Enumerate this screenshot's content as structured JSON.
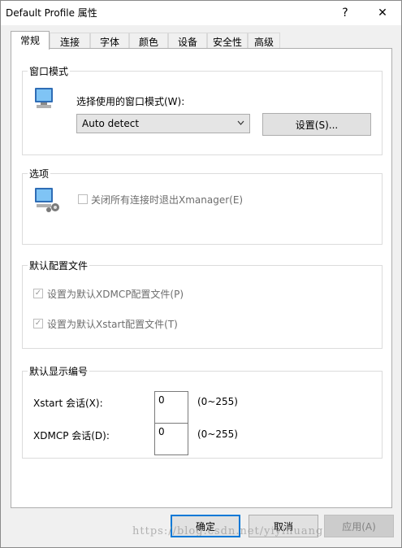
{
  "window": {
    "title": "Default Profile 属性",
    "help": "?",
    "close": "✕"
  },
  "tabs": [
    "常规",
    "连接",
    "字体",
    "颜色",
    "设备",
    "安全性",
    "高级"
  ],
  "window_mode": {
    "group_title": "窗口模式",
    "prompt": "选择使用的窗口模式(W):",
    "select_value": "Auto detect",
    "settings_button": "设置(S)..."
  },
  "options": {
    "group_title": "选项",
    "exit_checkbox_label": "关闭所有连接时退出Xmanager(E)",
    "exit_checked": false
  },
  "default_profile": {
    "group_title": "默认配置文件",
    "xdmcp_label": "设置为默认XDMCP配置文件(P)",
    "xdmcp_checked": true,
    "xstart_label": "设置为默认Xstart配置文件(T)",
    "xstart_checked": true
  },
  "display_number": {
    "group_title": "默认显示编号",
    "xstart_label": "Xstart 会话(X):",
    "xstart_value": "0",
    "xstart_range": "(0~255)",
    "xdmcp_label": "XDMCP 会话(D):",
    "xdmcp_value": "0",
    "xdmcp_range": "(0~255)"
  },
  "footer": {
    "ok": "确定",
    "cancel": "取消",
    "apply": "应用(A)"
  },
  "watermark": "https://blog.csdn.net/yiyihuang"
}
